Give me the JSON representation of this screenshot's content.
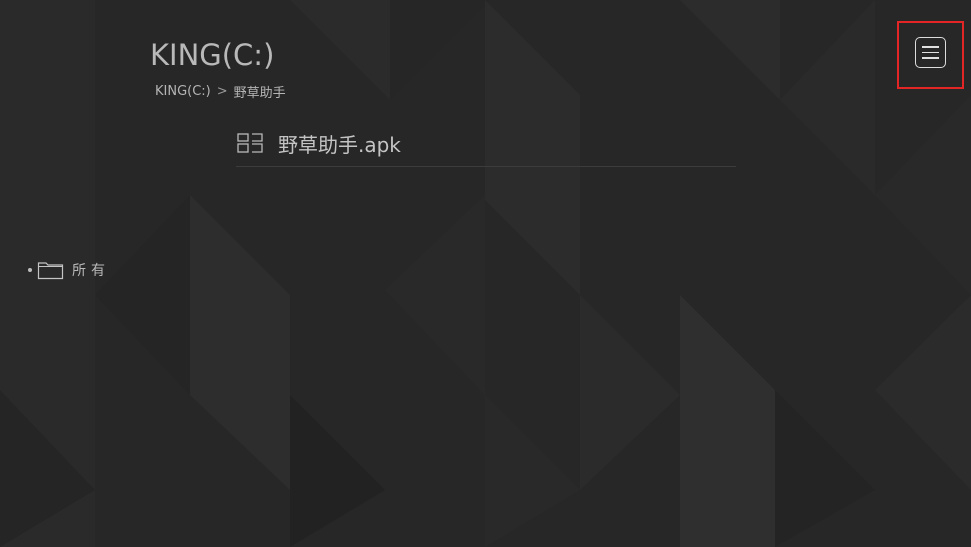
{
  "header": {
    "title": "KING(C:)"
  },
  "breadcrumb": {
    "root": "KING(C:)",
    "separator": ">",
    "current": "野草助手"
  },
  "files": [
    {
      "name": "野草助手.apk",
      "icon": "grid-view-icon"
    }
  ],
  "sidebar": {
    "items": [
      {
        "label": "所有",
        "icon": "folder-icon"
      }
    ]
  },
  "toolbar": {
    "menu_icon": "menu-icon"
  },
  "colors": {
    "background": "#272727",
    "text": "#b9b9b9",
    "highlight": "#e42525"
  }
}
